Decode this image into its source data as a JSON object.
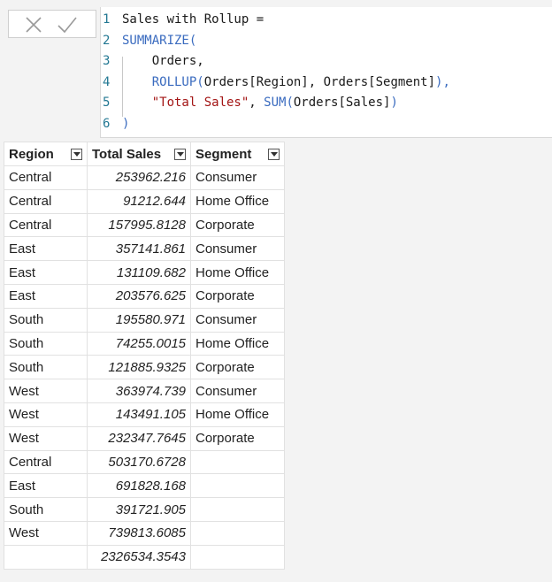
{
  "toolbar": {
    "cancel_icon": "close-icon",
    "commit_icon": "check-icon"
  },
  "editor": {
    "lines": [
      {
        "num": "1",
        "parts": [
          {
            "t": "Sales with Rollup =",
            "c": "code"
          }
        ]
      },
      {
        "num": "2",
        "parts": [
          {
            "t": "SUMMARIZE(",
            "c": "fn"
          }
        ]
      },
      {
        "num": "3",
        "parts": [
          {
            "t": "    Orders,",
            "c": "code"
          }
        ]
      },
      {
        "num": "4",
        "parts": [
          {
            "t": "    ",
            "c": "code"
          },
          {
            "t": "ROLLUP(",
            "c": "fn"
          },
          {
            "t": "Orders[Region], Orders[Segment]",
            "c": "code"
          },
          {
            "t": "),",
            "c": "fn"
          }
        ]
      },
      {
        "num": "5",
        "parts": [
          {
            "t": "    ",
            "c": "code"
          },
          {
            "t": "\"Total Sales\"",
            "c": "str"
          },
          {
            "t": ", ",
            "c": "code"
          },
          {
            "t": "SUM(",
            "c": "fn"
          },
          {
            "t": "Orders[Sales]",
            "c": "code"
          },
          {
            "t": ")",
            "c": "fn"
          }
        ]
      },
      {
        "num": "6",
        "parts": [
          {
            "t": ")",
            "c": "fn"
          }
        ]
      }
    ]
  },
  "table": {
    "columns": [
      "Region",
      "Total Sales",
      "Segment"
    ],
    "rows": [
      [
        "Central",
        "253962.216",
        "Consumer"
      ],
      [
        "Central",
        "91212.644",
        "Home Office"
      ],
      [
        "Central",
        "157995.8128",
        "Corporate"
      ],
      [
        "East",
        "357141.861",
        "Consumer"
      ],
      [
        "East",
        "131109.682",
        "Home Office"
      ],
      [
        "East",
        "203576.625",
        "Corporate"
      ],
      [
        "South",
        "195580.971",
        "Consumer"
      ],
      [
        "South",
        "74255.0015",
        "Home Office"
      ],
      [
        "South",
        "121885.9325",
        "Corporate"
      ],
      [
        "West",
        "363974.739",
        "Consumer"
      ],
      [
        "West",
        "143491.105",
        "Home Office"
      ],
      [
        "West",
        "232347.7645",
        "Corporate"
      ],
      [
        "Central",
        "503170.6728",
        ""
      ],
      [
        "East",
        "691828.168",
        ""
      ],
      [
        "South",
        "391721.905",
        ""
      ],
      [
        "West",
        "739813.6085",
        ""
      ],
      [
        "",
        "2326534.3543",
        ""
      ]
    ]
  }
}
